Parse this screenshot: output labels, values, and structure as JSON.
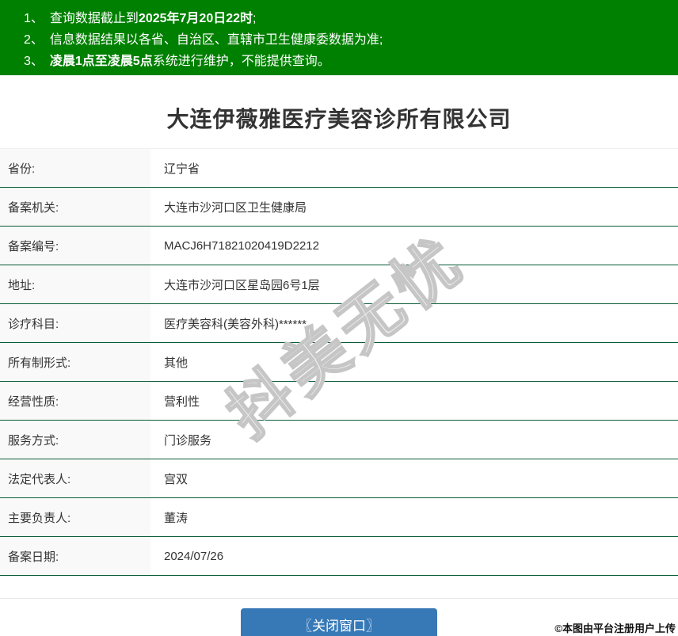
{
  "banner": {
    "notices": [
      {
        "num": "1、",
        "pre": "查询数据截止到",
        "bold": "2025年7月20日22时",
        "post": ";"
      },
      {
        "num": "2、",
        "pre": "信息数据结果以各省、自治区、直辖市卫生健康委数据为准",
        "bold": "",
        "post": ";"
      },
      {
        "num": "3、",
        "pre": "",
        "bold": "凌晨1点至凌晨5点",
        "post": "系统进行维护，不能提供查询。"
      }
    ]
  },
  "page": {
    "title": "大连伊薇雅医疗美容诊所有限公司"
  },
  "table": {
    "rows": [
      {
        "label": "省份:",
        "value": "辽宁省"
      },
      {
        "label": "备案机关:",
        "value": "大连市沙河口区卫生健康局"
      },
      {
        "label": "备案编号:",
        "value": "MACJ6H71821020419D2212"
      },
      {
        "label": "地址:",
        "value": "大连市沙河口区星岛园6号1层"
      },
      {
        "label": "诊疗科目:",
        "value": "医疗美容科(美容外科)******"
      },
      {
        "label": "所有制形式:",
        "value": "其他"
      },
      {
        "label": "经营性质:",
        "value": "营利性"
      },
      {
        "label": "服务方式:",
        "value": "门诊服务"
      },
      {
        "label": "法定代表人:",
        "value": "宫双"
      },
      {
        "label": "主要负责人:",
        "value": "董涛"
      },
      {
        "label": "备案日期:",
        "value": "2024/07/26"
      }
    ]
  },
  "footer": {
    "close_button_label": "〖关闭窗口〗"
  },
  "watermark": {
    "text": "抖美无忧"
  },
  "copyright": {
    "text": "©本图由平台注册用户上传"
  },
  "colors": {
    "banner_green": "#008000",
    "row_divider_green": "#085c36",
    "label_bg": "#f9f9f9",
    "text": "#333333",
    "button_blue": "#3779b7"
  }
}
